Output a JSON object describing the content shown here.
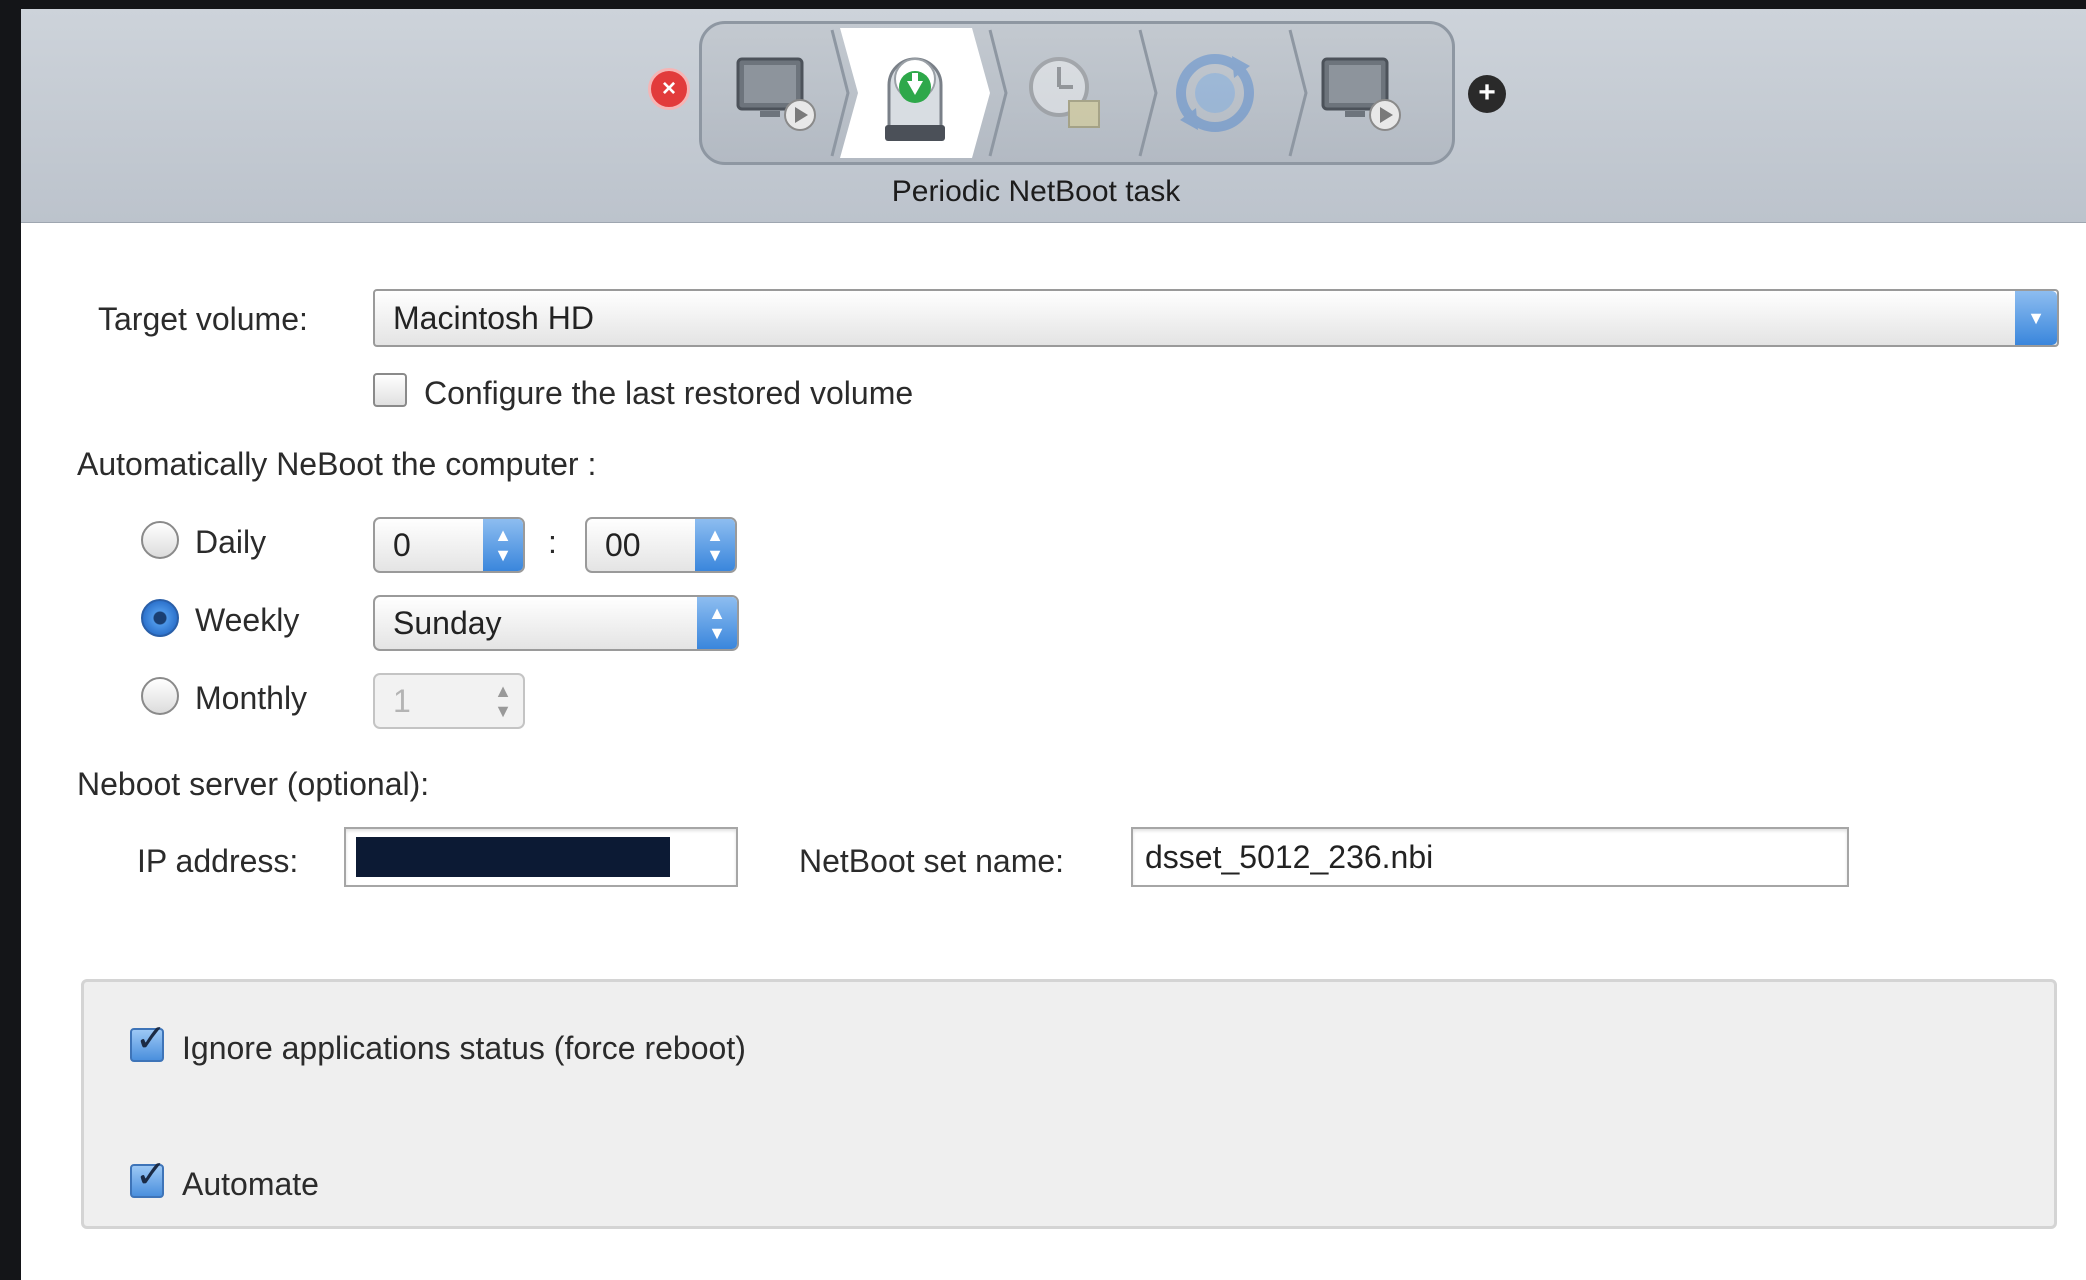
{
  "toolbar": {
    "task_title": "Periodic NetBoot task",
    "steps": [
      {
        "name": "netboot-icon",
        "state": "inactive"
      },
      {
        "name": "restore-disk-icon",
        "state": "selected"
      },
      {
        "name": "schedule-icon",
        "state": "inactive"
      },
      {
        "name": "refresh-icon",
        "state": "inactive"
      },
      {
        "name": "netboot-icon",
        "state": "inactive"
      }
    ],
    "remove_label": "×",
    "add_label": "+"
  },
  "form": {
    "target_volume_label": "Target volume:",
    "target_volume_value": "Macintosh HD",
    "configure_last_label": "Configure the last restored volume",
    "configure_last_checked": false,
    "auto_netboot_label": "Automatically NeBoot the computer :",
    "schedule": {
      "daily_label": "Daily",
      "weekly_label": "Weekly",
      "monthly_label": "Monthly",
      "selected": "Weekly",
      "hour_value": "0",
      "time_separator": ":",
      "minute_value": "00",
      "weekday_value": "Sunday",
      "monthday_value": "1"
    },
    "server_label": "Neboot server (optional):",
    "ip_label": "IP address:",
    "netboot_set_label": "NetBoot set name:",
    "netboot_set_value": "dsset_5012_236.nbi"
  },
  "options": {
    "ignore_apps_label": "Ignore applications status (force reboot)",
    "ignore_apps_checked": true,
    "automate_label": "Automate",
    "automate_checked": true
  },
  "colors": {
    "toolbar_bg": "#c4cad2",
    "accent_blue": "#3a86dc",
    "remove_red": "#e23b3b"
  }
}
